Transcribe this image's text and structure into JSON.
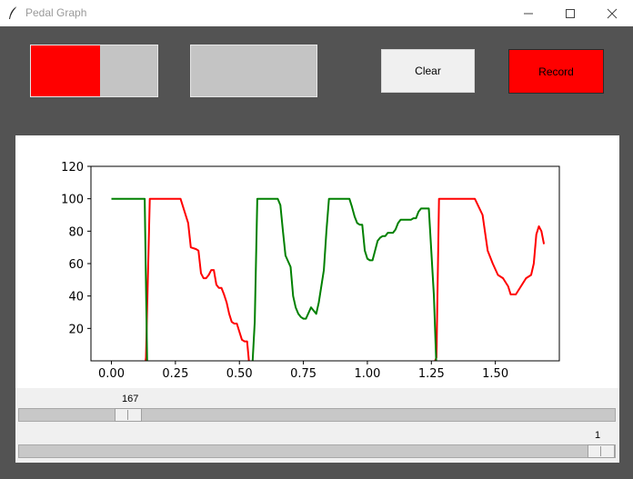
{
  "window": {
    "title": "Pedal Graph",
    "controls": [
      "minimize-icon",
      "maximize-icon",
      "close-icon"
    ]
  },
  "meters": [
    {
      "name": "throttle-meter",
      "level": 0.55,
      "fill_color": "#ff0000"
    },
    {
      "name": "brake-meter",
      "level": 0.0,
      "fill_color": "#ff0000"
    }
  ],
  "buttons": {
    "clear_label": "Clear",
    "record_label": "Record",
    "record_color": "#ff0000"
  },
  "chart_data": {
    "type": "line",
    "title": "",
    "xlabel": "",
    "ylabel": "",
    "xlim": [
      -0.08,
      1.75
    ],
    "ylim": [
      0,
      120
    ],
    "x_ticks": [
      "0.00",
      "0.25",
      "0.50",
      "0.75",
      "1.00",
      "1.25",
      "1.50"
    ],
    "y_ticks": [
      "20",
      "40",
      "60",
      "80",
      "100",
      "120"
    ],
    "grid": false,
    "series": [
      {
        "color": "#ff0000",
        "points": [
          [
            0.0,
            -5
          ],
          [
            0.13,
            -5
          ],
          [
            0.135,
            2
          ],
          [
            0.15,
            100
          ],
          [
            0.27,
            100
          ],
          [
            0.3,
            85
          ],
          [
            0.31,
            70
          ],
          [
            0.33,
            69
          ],
          [
            0.34,
            68
          ],
          [
            0.35,
            54
          ],
          [
            0.36,
            51
          ],
          [
            0.37,
            51
          ],
          [
            0.38,
            53
          ],
          [
            0.39,
            56
          ],
          [
            0.4,
            56
          ],
          [
            0.41,
            47
          ],
          [
            0.42,
            45
          ],
          [
            0.43,
            45
          ],
          [
            0.44,
            41
          ],
          [
            0.45,
            36
          ],
          [
            0.46,
            29
          ],
          [
            0.47,
            24
          ],
          [
            0.48,
            23
          ],
          [
            0.49,
            23
          ],
          [
            0.5,
            18
          ],
          [
            0.51,
            13
          ],
          [
            0.52,
            12
          ],
          [
            0.53,
            12
          ],
          [
            0.54,
            -5
          ],
          [
            0.55,
            -5
          ],
          [
            1.25,
            -5
          ],
          [
            1.27,
            2
          ],
          [
            1.28,
            100
          ],
          [
            1.42,
            100
          ],
          [
            1.45,
            90
          ],
          [
            1.47,
            68
          ],
          [
            1.49,
            60
          ],
          [
            1.51,
            53
          ],
          [
            1.53,
            51
          ],
          [
            1.55,
            46
          ],
          [
            1.56,
            41
          ],
          [
            1.57,
            41
          ],
          [
            1.58,
            41
          ],
          [
            1.6,
            46
          ],
          [
            1.62,
            51
          ],
          [
            1.64,
            53
          ],
          [
            1.65,
            60
          ],
          [
            1.66,
            78
          ],
          [
            1.67,
            83
          ],
          [
            1.68,
            80
          ],
          [
            1.69,
            72
          ]
        ]
      },
      {
        "color": "#008000",
        "points": [
          [
            0.0,
            100
          ],
          [
            0.13,
            100
          ],
          [
            0.14,
            -5
          ],
          [
            0.15,
            -5
          ],
          [
            0.55,
            -5
          ],
          [
            0.56,
            24
          ],
          [
            0.57,
            100
          ],
          [
            0.65,
            100
          ],
          [
            0.66,
            96
          ],
          [
            0.67,
            80
          ],
          [
            0.68,
            65
          ],
          [
            0.7,
            58
          ],
          [
            0.71,
            40
          ],
          [
            0.72,
            33
          ],
          [
            0.73,
            29
          ],
          [
            0.74,
            27
          ],
          [
            0.75,
            26
          ],
          [
            0.76,
            26
          ],
          [
            0.78,
            33
          ],
          [
            0.8,
            29
          ],
          [
            0.81,
            36
          ],
          [
            0.83,
            56
          ],
          [
            0.84,
            80
          ],
          [
            0.85,
            100
          ],
          [
            0.93,
            100
          ],
          [
            0.94,
            95
          ],
          [
            0.95,
            89
          ],
          [
            0.96,
            85
          ],
          [
            0.97,
            84
          ],
          [
            0.98,
            84
          ],
          [
            0.99,
            68
          ],
          [
            1.0,
            63
          ],
          [
            1.01,
            62
          ],
          [
            1.02,
            62
          ],
          [
            1.03,
            68
          ],
          [
            1.04,
            74
          ],
          [
            1.05,
            76
          ],
          [
            1.06,
            77
          ],
          [
            1.07,
            77
          ],
          [
            1.08,
            79
          ],
          [
            1.09,
            79
          ],
          [
            1.1,
            79
          ],
          [
            1.11,
            81
          ],
          [
            1.12,
            85
          ],
          [
            1.13,
            87
          ],
          [
            1.14,
            87
          ],
          [
            1.15,
            87
          ],
          [
            1.16,
            87
          ],
          [
            1.17,
            87
          ],
          [
            1.18,
            88
          ],
          [
            1.19,
            88
          ],
          [
            1.2,
            92
          ],
          [
            1.21,
            94
          ],
          [
            1.22,
            94
          ],
          [
            1.23,
            94
          ],
          [
            1.24,
            94
          ],
          [
            1.26,
            40
          ],
          [
            1.27,
            -5
          ]
        ]
      }
    ]
  },
  "sliders": [
    {
      "name": "position-slider",
      "value_label": "167",
      "fraction": 0.168
    },
    {
      "name": "zoom-slider",
      "value_label": "1",
      "fraction": 1.0
    }
  ]
}
